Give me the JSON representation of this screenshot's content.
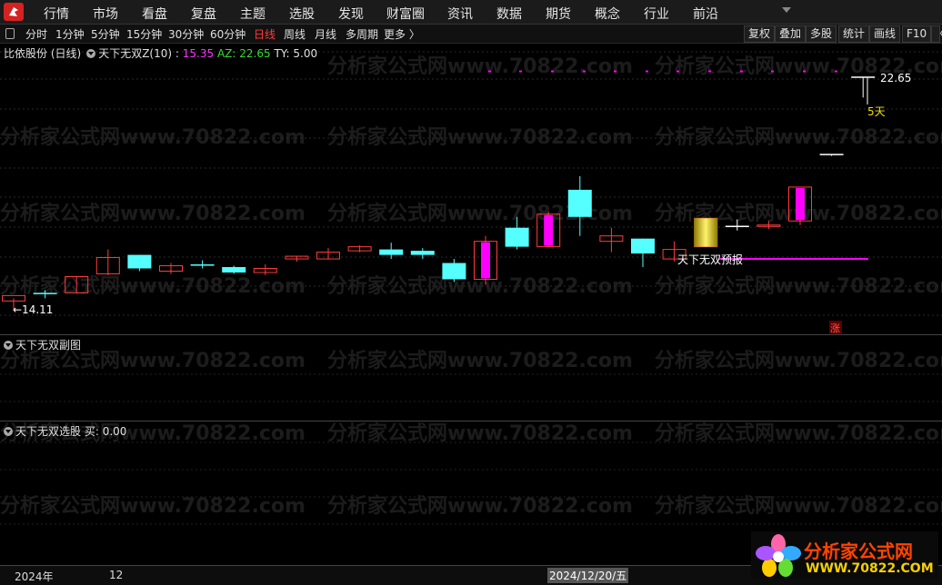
{
  "menu": [
    "行情",
    "市场",
    "看盘",
    "复盘",
    "主题",
    "选股",
    "发现",
    "财富圈",
    "资讯",
    "数据",
    "期货",
    "概念",
    "行业",
    "前沿"
  ],
  "periods": [
    "分时",
    "1分钟",
    "5分钟",
    "15分钟",
    "30分钟",
    "60分钟",
    "日线",
    "周线",
    "月线",
    "多周期",
    "更多 〉"
  ],
  "active_period": "日线",
  "tools": [
    "复权",
    "叠加",
    "多股",
    "统计",
    "画线",
    "F10"
  ],
  "main_pane": {
    "stock": "比依股份 (日线)",
    "indicator": "天下无双Z(10)",
    "colon": ":",
    "value1": "15.35",
    "az_label": "AZ:",
    "az_value": "22.65",
    "ty_label": "TY:",
    "ty_value": "5.00",
    "high_label": "22.65",
    "low_label": "←14.11",
    "days_label": "5天",
    "signal_label": "天下无双预报",
    "zhang_label": "涨"
  },
  "sub_pane1": {
    "title": "天下无双副图"
  },
  "sub_pane2": {
    "title": "天下无双选股",
    "buy_label": "买:",
    "buy_value": "0.00"
  },
  "xaxis": {
    "year": "2024年",
    "month": "12",
    "cursor_date": "2024/12/20/五"
  },
  "watermark": "分析家公式网www.70822.com",
  "brand": {
    "title": "分析家公式网",
    "url": "WWW.70822.COM"
  },
  "colors": {
    "up": "#ff3c3c",
    "down": "#55ffff",
    "magenta": "#ff00ff",
    "gold": "#f0e000",
    "background": "#000000"
  },
  "chart_data": {
    "type": "candlestick",
    "price_range": [
      14.11,
      22.65
    ],
    "candles": [
      {
        "o": 14.4,
        "h": 14.5,
        "l": 14.1,
        "c": 14.6,
        "dir": "up"
      },
      {
        "o": 14.7,
        "h": 14.8,
        "l": 14.5,
        "c": 14.65,
        "dir": "down"
      },
      {
        "o": 14.7,
        "h": 15.3,
        "l": 14.7,
        "c": 15.3,
        "dir": "up"
      },
      {
        "o": 15.4,
        "h": 16.3,
        "l": 15.35,
        "c": 16.0,
        "dir": "up"
      },
      {
        "o": 16.1,
        "h": 16.1,
        "l": 15.5,
        "c": 15.6,
        "dir": "down"
      },
      {
        "o": 15.5,
        "h": 15.8,
        "l": 15.4,
        "c": 15.7,
        "dir": "up"
      },
      {
        "o": 15.75,
        "h": 15.9,
        "l": 15.6,
        "c": 15.7,
        "dir": "down"
      },
      {
        "o": 15.65,
        "h": 15.7,
        "l": 15.4,
        "c": 15.45,
        "dir": "down"
      },
      {
        "o": 15.45,
        "h": 15.75,
        "l": 15.35,
        "c": 15.6,
        "dir": "up"
      },
      {
        "o": 15.95,
        "h": 16.05,
        "l": 15.85,
        "c": 16.05,
        "dir": "up"
      },
      {
        "o": 15.95,
        "h": 16.35,
        "l": 15.95,
        "c": 16.2,
        "dir": "up"
      },
      {
        "o": 16.25,
        "h": 16.45,
        "l": 16.2,
        "c": 16.4,
        "dir": "up"
      },
      {
        "o": 16.3,
        "h": 16.55,
        "l": 15.95,
        "c": 16.1,
        "dir": "down"
      },
      {
        "o": 16.25,
        "h": 16.35,
        "l": 15.95,
        "c": 16.1,
        "dir": "down"
      },
      {
        "o": 15.8,
        "h": 15.95,
        "l": 15.1,
        "c": 15.2,
        "dir": "down"
      },
      {
        "o": 15.2,
        "h": 16.8,
        "l": 15.0,
        "c": 16.6,
        "dir": "up",
        "fill": "magenta"
      },
      {
        "o": 17.1,
        "h": 17.5,
        "l": 16.3,
        "c": 16.4,
        "dir": "down"
      },
      {
        "o": 16.4,
        "h": 17.7,
        "l": 16.4,
        "c": 17.6,
        "dir": "up",
        "fill": "magenta"
      },
      {
        "o": 18.5,
        "h": 19.0,
        "l": 16.8,
        "c": 17.5,
        "dir": "down"
      },
      {
        "o": 16.8,
        "h": 17.1,
        "l": 16.2,
        "c": 16.6,
        "dir": "up"
      },
      {
        "o": 16.7,
        "h": 16.7,
        "l": 15.65,
        "c": 16.15,
        "dir": "down"
      },
      {
        "o": 16.3,
        "h": 16.6,
        "l": 15.85,
        "c": 15.95,
        "dir": "up"
      },
      {
        "o": 16.4,
        "h": 17.45,
        "l": 16.4,
        "c": 17.45,
        "dir": "up",
        "fill": "gold"
      },
      {
        "o": 17.15,
        "h": 17.4,
        "l": 17.0,
        "c": 17.15,
        "dir": "flat"
      },
      {
        "o": 17.15,
        "h": 17.35,
        "l": 17.05,
        "c": 17.2,
        "dir": "up"
      },
      {
        "o": 17.35,
        "h": 18.55,
        "l": 17.2,
        "c": 18.6,
        "dir": "up",
        "fill": "magenta"
      },
      {
        "o": 19.75,
        "h": 19.8,
        "l": 19.75,
        "c": 19.8,
        "dir": "flat"
      },
      {
        "o": 22.6,
        "h": 22.65,
        "l": 21.9,
        "c": 22.65,
        "dir": "flat"
      }
    ],
    "signal_line_value": 15.95,
    "dot_row_value": 22.9
  }
}
